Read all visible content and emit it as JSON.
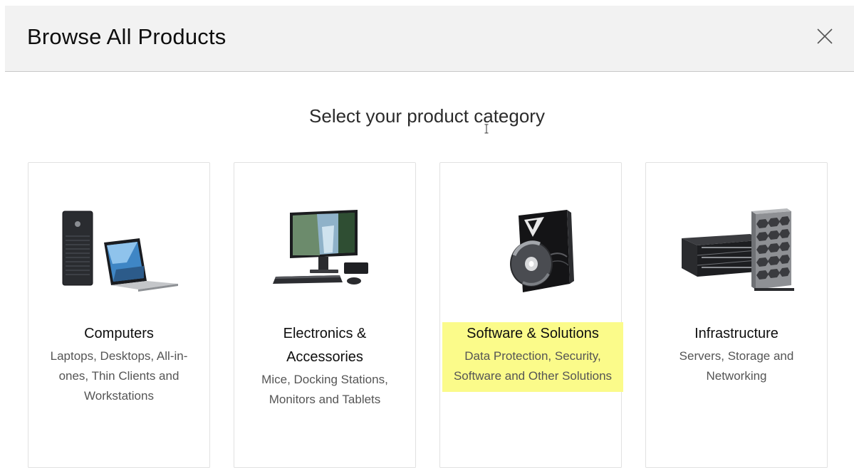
{
  "header": {
    "title": "Browse All Products"
  },
  "main": {
    "subtitle": "Select your product category"
  },
  "categories": [
    {
      "title": "Computers",
      "description": "Laptops, Desktops, All-in-ones, Thin Clients and Workstations"
    },
    {
      "title": "Electronics & Accessories",
      "description": "Mice, Docking Stations, Monitors and Tablets"
    },
    {
      "title": "Software & Solutions",
      "description": "Data Protection, Security, Software and Other Solutions"
    },
    {
      "title": "Infrastructure",
      "description": "Servers, Storage and Networking"
    }
  ],
  "colors": {
    "highlight": "#fbfb8a",
    "header_bg": "#f2f2f2"
  },
  "icons": [
    "close-icon",
    "text-cursor-icon",
    "desktop-laptop-image",
    "all-in-one-monitor-image",
    "software-box-disc-image",
    "server-rack-tower-image"
  ]
}
